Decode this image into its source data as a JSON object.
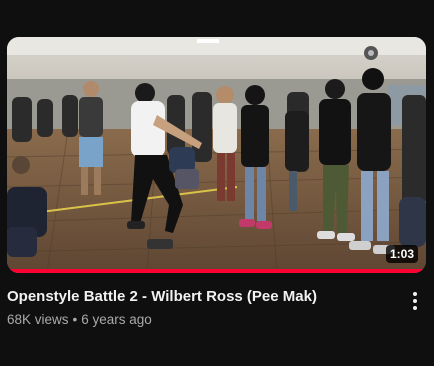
{
  "video": {
    "title": "Openstyle Battle 2 - Wilbert Ross (Pee Mak)",
    "views": "68K views",
    "separator": "•",
    "age": "6 years ago",
    "duration": "1:03",
    "progress_fraction": 1.0
  },
  "colors": {
    "background": "#0f0f0f",
    "progress": "#ff0033",
    "title_text": "#f1f1f1",
    "meta_text": "#aaaaaa"
  },
  "icons": {
    "menu": "more-vert-icon"
  }
}
